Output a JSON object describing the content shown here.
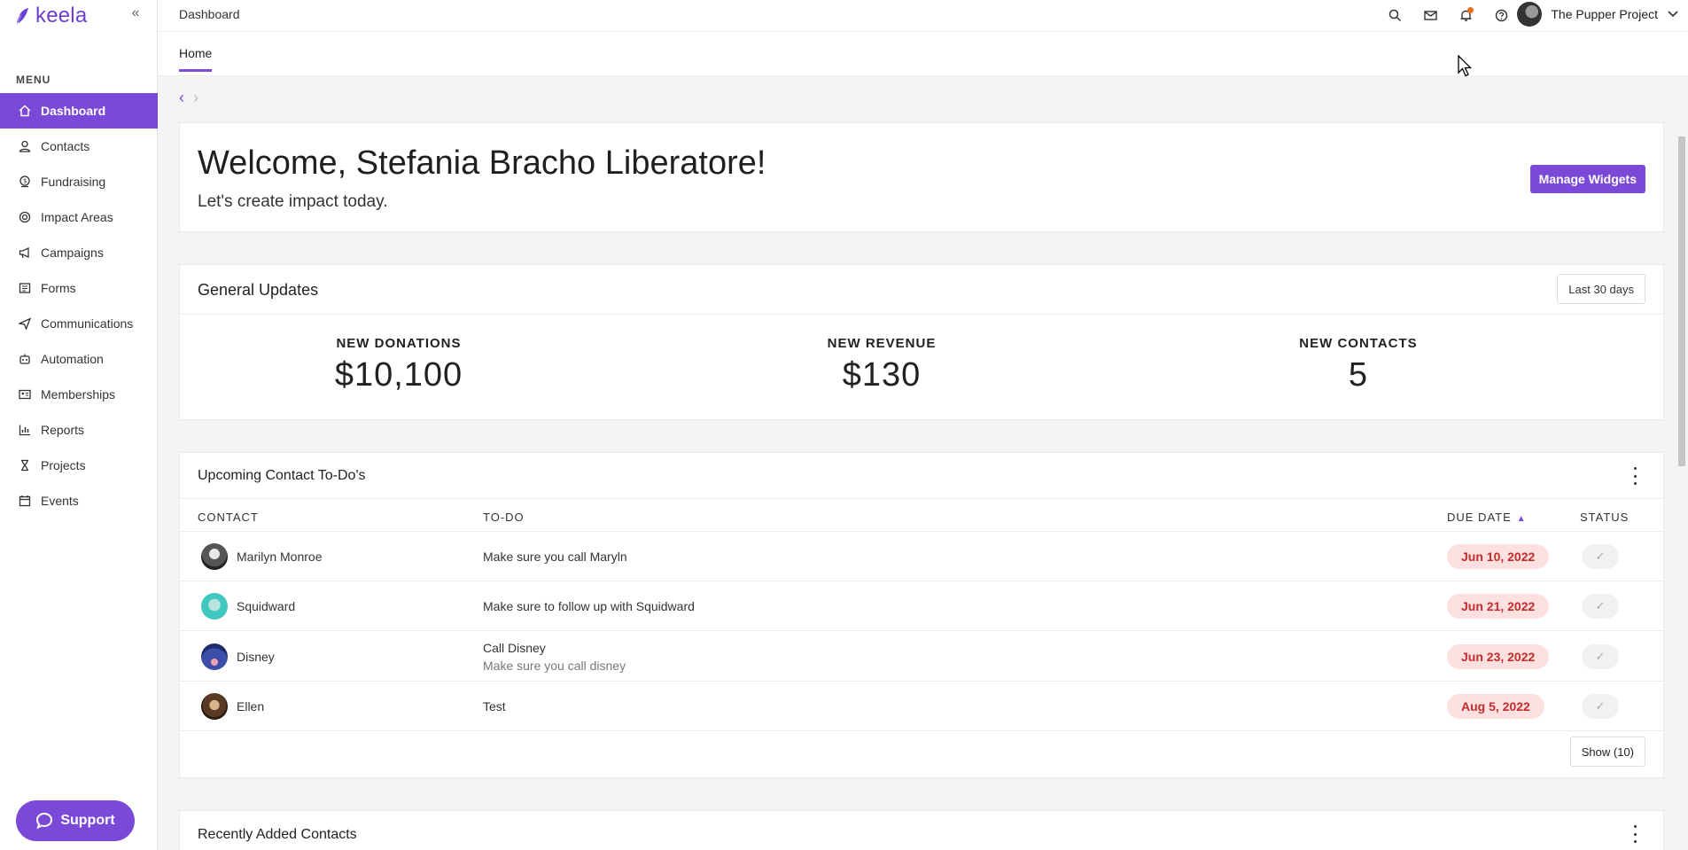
{
  "app": {
    "logo_text": "keela",
    "collapse_glyph": "«"
  },
  "sidebar": {
    "menu_label": "MENU",
    "items": [
      {
        "label": "Dashboard",
        "icon": "home-icon",
        "active": true
      },
      {
        "label": "Contacts",
        "icon": "person-icon"
      },
      {
        "label": "Fundraising",
        "icon": "donation-icon"
      },
      {
        "label": "Impact Areas",
        "icon": "target-icon"
      },
      {
        "label": "Campaigns",
        "icon": "megaphone-icon"
      },
      {
        "label": "Forms",
        "icon": "form-icon"
      },
      {
        "label": "Communications",
        "icon": "send-icon"
      },
      {
        "label": "Automation",
        "icon": "robot-icon"
      },
      {
        "label": "Memberships",
        "icon": "id-card-icon"
      },
      {
        "label": "Reports",
        "icon": "bar-chart-icon"
      },
      {
        "label": "Projects",
        "icon": "hourglass-icon"
      },
      {
        "label": "Events",
        "icon": "calendar-icon"
      }
    ],
    "support_label": "Support"
  },
  "topbar": {
    "breadcrumb": "Dashboard",
    "account_name": "The Pupper Project"
  },
  "tabs": {
    "home": "Home"
  },
  "welcome": {
    "title": "Welcome, Stefania Bracho Liberatore!",
    "subtitle": "Let's create impact today.",
    "manage_widgets": "Manage Widgets"
  },
  "updates": {
    "title": "General Updates",
    "range": "Last 30 days",
    "stats": [
      {
        "label": "NEW DONATIONS",
        "value": "$10,100"
      },
      {
        "label": "NEW REVENUE",
        "value": "$130"
      },
      {
        "label": "NEW CONTACTS",
        "value": "5"
      }
    ]
  },
  "todos": {
    "title": "Upcoming Contact To-Do's",
    "columns": {
      "contact": "CONTACT",
      "todo": "TO-DO",
      "due": "DUE DATE",
      "status": "STATUS"
    },
    "rows": [
      {
        "contact": "Marilyn Monroe",
        "todo": "Make sure you call Maryln",
        "note": "",
        "due": "Jun 10, 2022"
      },
      {
        "contact": "Squidward",
        "todo": "Make sure to follow up with Squidward",
        "note": "",
        "due": "Jun 21, 2022"
      },
      {
        "contact": "Disney",
        "todo": "Call Disney",
        "note": "Make sure you call disney",
        "due": "Jun 23, 2022"
      },
      {
        "contact": "Ellen",
        "todo": "Test",
        "note": "",
        "due": "Aug 5, 2022"
      }
    ],
    "show_more": "Show (10)"
  },
  "recent": {
    "title": "Recently Added Contacts"
  },
  "colors": {
    "accent": "#7b49d8",
    "due_bg": "#fde1e1",
    "due_text": "#c42b2b",
    "notification": "#e8711c"
  }
}
